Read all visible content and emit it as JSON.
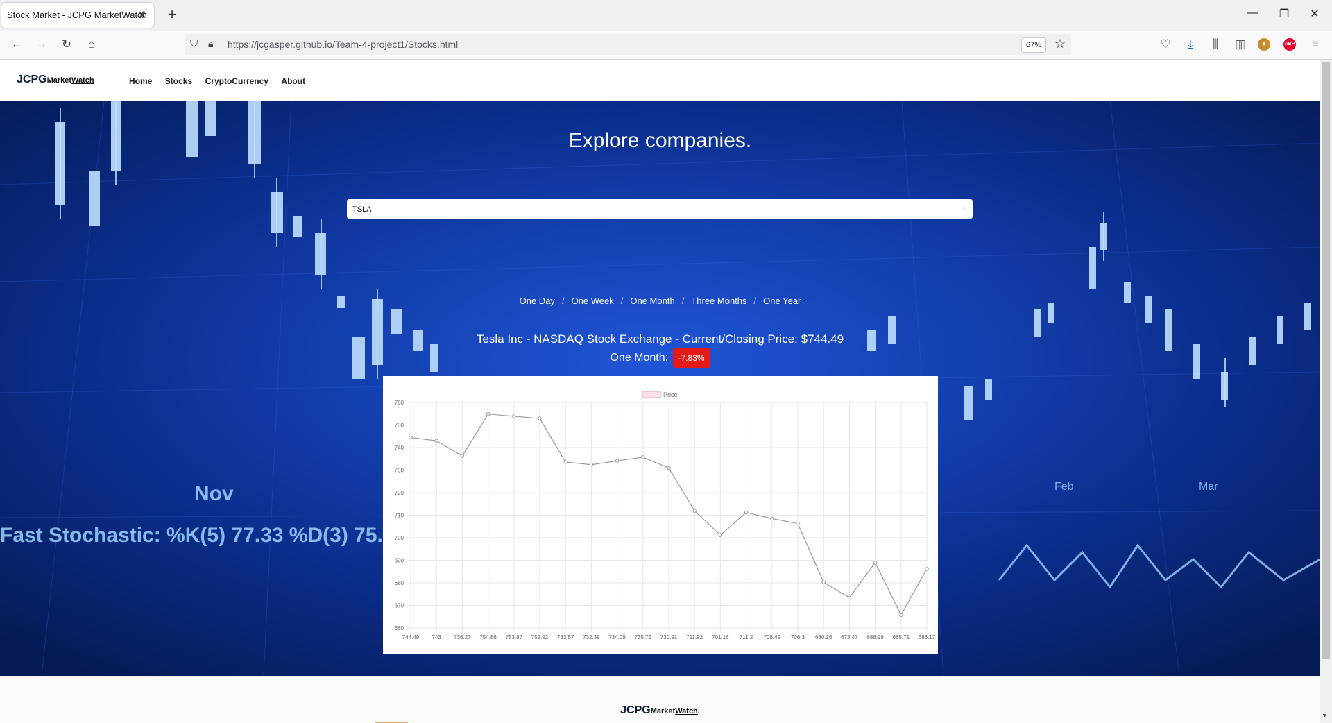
{
  "browser": {
    "tab_title": "Stock Market - JCPG MarketWatch",
    "url": "https://jcgasper.github.io/Team-4-project1/Stocks.html",
    "zoom": "67%",
    "abp_label": "ABP"
  },
  "site": {
    "logo": {
      "bold": "JCPG",
      "market": "Market",
      "watch": "Watch"
    },
    "nav": [
      "Home",
      "Stocks",
      "CryptoCurrency",
      "About"
    ]
  },
  "hero": {
    "title": "Explore companies.",
    "search_value": "TSLA",
    "ranges": [
      "One Day",
      "One Week",
      "One Month",
      "Three Months",
      "One Year"
    ],
    "separator": "/",
    "stock_title": "Tesla Inc - NASDAQ Stock Exchange - Current/Closing Price: $744.49",
    "period_label": "One Month:",
    "change": "-7.83%",
    "change_color": "#e41a1a"
  },
  "footer": {
    "bold": "JCPG",
    "market": "Market",
    "watch": "Watch",
    "dot": "."
  },
  "chart_data": {
    "type": "line",
    "legend": [
      "Price"
    ],
    "categories": [
      "744.49",
      "743",
      "736.27",
      "754.86",
      "753.87",
      "752.92",
      "733.57",
      "732.39",
      "734.09",
      "735.72",
      "730.91",
      "711.92",
      "701.16",
      "711.2",
      "708.49",
      "706.3",
      "680.26",
      "673.47",
      "688.99",
      "665.71",
      "686.17"
    ],
    "series": [
      {
        "name": "Price",
        "values": [
          744.49,
          743,
          736.27,
          754.86,
          753.87,
          752.92,
          733.57,
          732.39,
          734.09,
          735.72,
          730.91,
          711.92,
          701.16,
          711.2,
          708.49,
          706.3,
          680.26,
          673.47,
          688.99,
          665.71,
          686.17
        ],
        "color": "#999999"
      }
    ],
    "ylim": [
      660,
      760
    ],
    "yticks": [
      760,
      750,
      740,
      730,
      720,
      710,
      700,
      690,
      680,
      670,
      660
    ],
    "grid": true,
    "legend_position": "top-center"
  }
}
